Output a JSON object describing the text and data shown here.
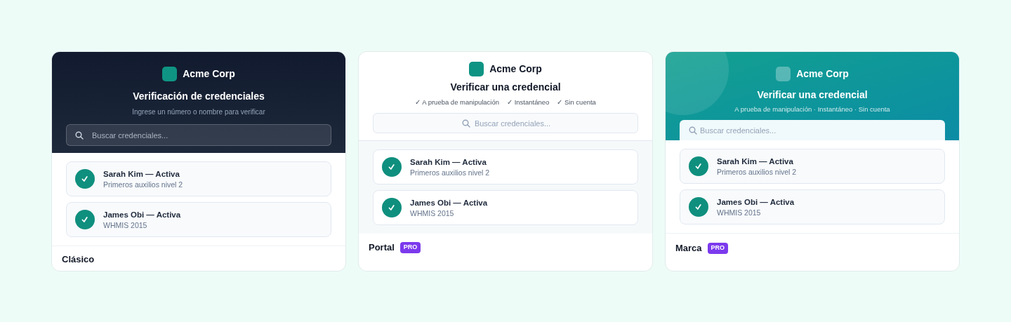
{
  "cards": [
    {
      "kind": "classic",
      "brand": "Acme Corp",
      "title": "Verificación de credenciales",
      "subtitle": "Ingrese un número o nombre para verificar",
      "search": {
        "placeholder": "Buscar credenciales..."
      },
      "credentials": [
        {
          "name": "Sarah Kim — Activa",
          "detail": "Primeros auxilios nivel 2"
        },
        {
          "name": "James Obi — Activa",
          "detail": "WHMIS 2015"
        }
      ],
      "label": "Clásico"
    },
    {
      "kind": "portal",
      "brand": "Acme Corp",
      "title": "Verificar una credencial",
      "features": [
        "✓ A prueba de manipulación",
        "✓ Instantáneo",
        "✓ Sin cuenta"
      ],
      "search": {
        "placeholder": "Buscar credenciales..."
      },
      "credentials": [
        {
          "name": "Sarah Kim — Activa",
          "detail": "Primeros auxilios nivel 2"
        },
        {
          "name": "James Obi — Activa",
          "detail": "WHMIS 2015"
        }
      ],
      "label": "Portal",
      "badge": "PRO"
    },
    {
      "kind": "brand",
      "brand": "Acme Corp",
      "title": "Verificar una credencial",
      "subtitle": "A prueba de manipulación · Instantáneo · Sin cuenta",
      "search": {
        "placeholder": "Buscar credenciales..."
      },
      "credentials": [
        {
          "name": "Sarah Kim — Activa",
          "detail": "Primeros auxilios nivel 2"
        },
        {
          "name": "James Obi — Activa",
          "detail": "WHMIS 2015"
        }
      ],
      "label": "Marca",
      "badge": "PRO"
    }
  ]
}
